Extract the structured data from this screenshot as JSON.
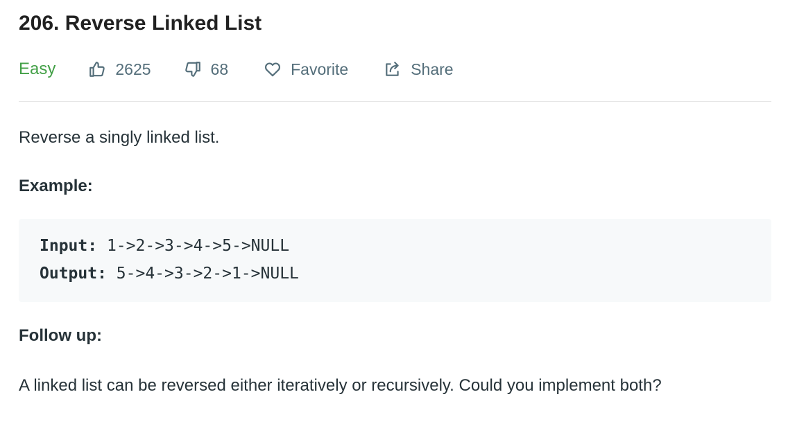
{
  "problem": {
    "title": "206. Reverse Linked List",
    "difficulty": "Easy",
    "likes": "2625",
    "dislikes": "68",
    "favorite_label": "Favorite",
    "share_label": "Share"
  },
  "content": {
    "description": "Reverse a singly linked list.",
    "example_heading": "Example:",
    "example": {
      "input_label": "Input:",
      "input_value": "1->2->3->4->5->NULL",
      "output_label": "Output:",
      "output_value": "5->4->3->2->1->NULL"
    },
    "followup_heading": "Follow up:",
    "followup_text": "A linked list can be reversed either iteratively or recursively. Could you implement both?"
  },
  "icons": {
    "like": "thumbs-up-icon",
    "dislike": "thumbs-down-icon",
    "favorite": "heart-icon",
    "share": "share-icon"
  },
  "colors": {
    "difficulty_easy": "#43a047",
    "meta_text": "#546e7a",
    "code_background": "#f7f9fa"
  }
}
